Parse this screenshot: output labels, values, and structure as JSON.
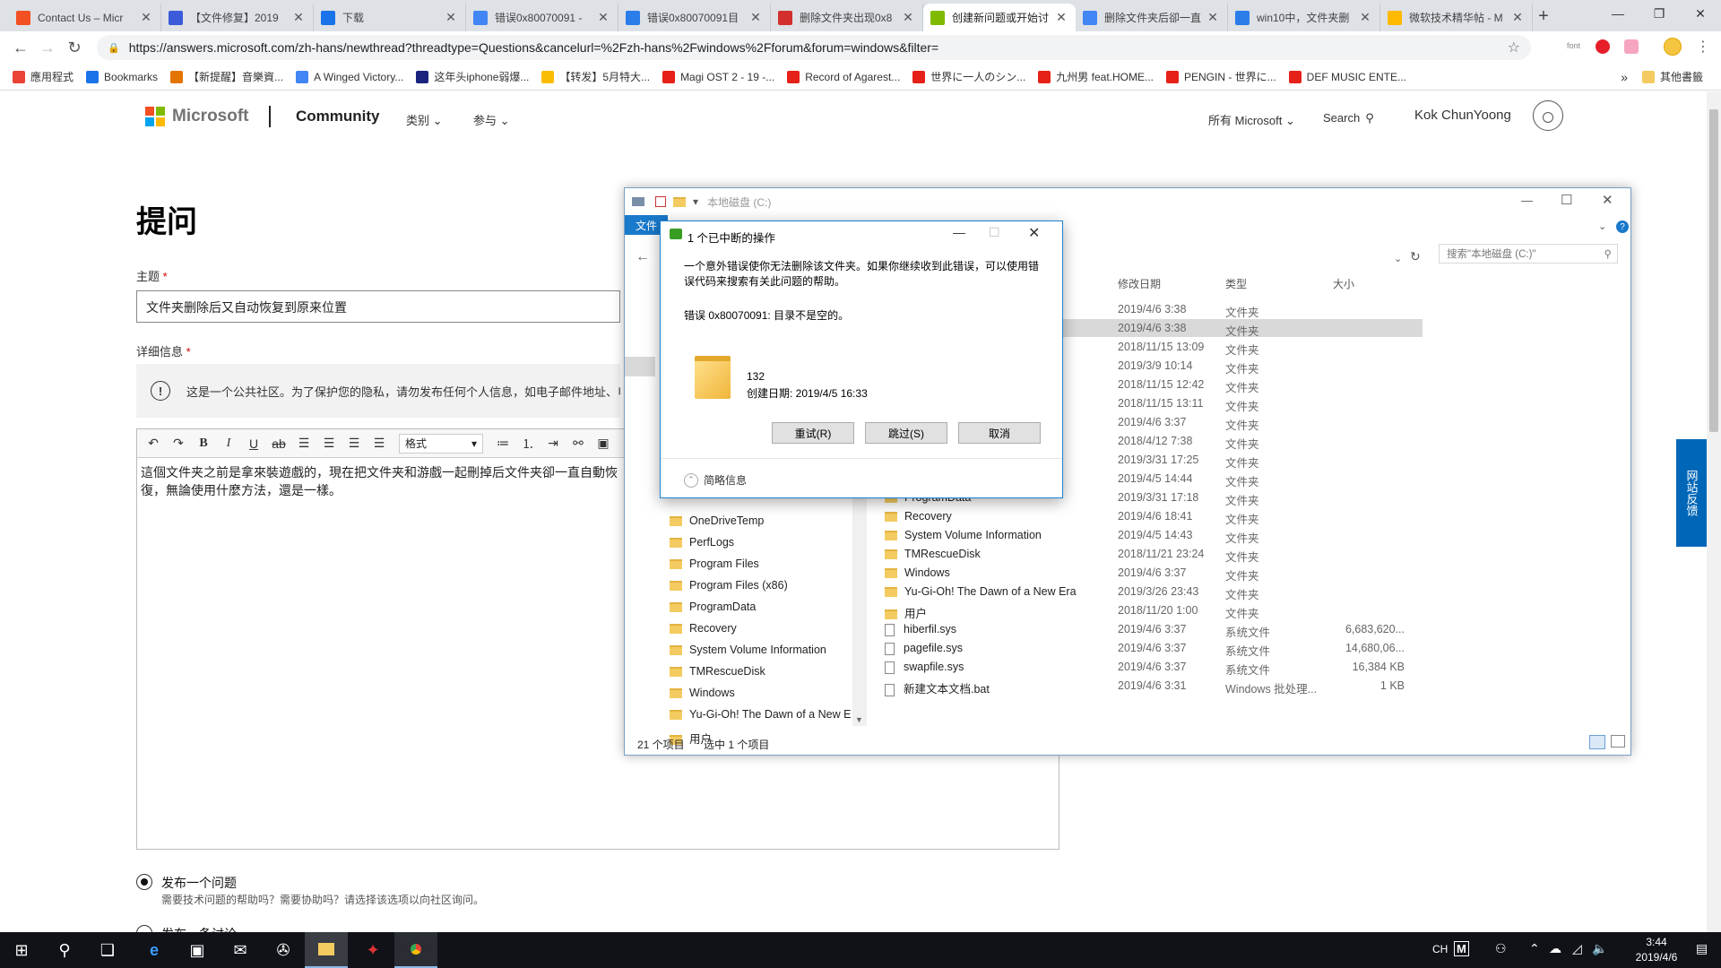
{
  "browser": {
    "tabs": [
      {
        "title": "Contact Us – Micr",
        "fav": "#f25022"
      },
      {
        "title": "【文件修复】2019",
        "fav": "#3b5bdb"
      },
      {
        "title": "下载",
        "fav": "#1a73e8"
      },
      {
        "title": "错误0x80070091 -",
        "fav": "#4285f4"
      },
      {
        "title": "错误0x80070091目",
        "fav": "#2b7de9"
      },
      {
        "title": "删除文件夹出现0x8",
        "fav": "#d32f2f"
      },
      {
        "title": "创建新问题或开始讨",
        "fav": "#7fba00"
      },
      {
        "title": "删除文件夹后卻一直",
        "fav": "#4285f4"
      },
      {
        "title": "win10中，文件夹删",
        "fav": "#2b7de9"
      },
      {
        "title": "微软技术精华帖 - M",
        "fav": "#ffb900"
      }
    ],
    "new_tab": "+",
    "win_minimize": "—",
    "win_restore": "❐",
    "win_close": "✕",
    "url": "https://answers.microsoft.com/zh-hans/newthread?threadtype=Questions&cancelurl=%2Fzh-hans%2Fwindows%2Fforum&forum=windows&filter=",
    "bookmarks": [
      {
        "label": "應用程式",
        "color": "#ea4335"
      },
      {
        "label": "Bookmarks",
        "color": "#1a73e8"
      },
      {
        "label": "【新提醒】音樂資...",
        "color": "#e37400"
      },
      {
        "label": "A Winged Victory...",
        "color": "#4285f4"
      },
      {
        "label": "这年头iphone弱爆...",
        "color": "#1a237e"
      },
      {
        "label": "【转发】5月特大...",
        "color": "#fbbc04"
      },
      {
        "label": "Magi OST 2 - 19 -...",
        "color": "#e62117"
      },
      {
        "label": "Record of Agarest...",
        "color": "#e62117"
      },
      {
        "label": "世界に一人のシン...",
        "color": "#e62117"
      },
      {
        "label": "九州男 feat.HOME...",
        "color": "#e62117"
      },
      {
        "label": "PENGIN - 世界に...",
        "color": "#e62117"
      },
      {
        "label": "DEF MUSIC ENTE...",
        "color": "#e62117"
      }
    ],
    "bookmarks_more": "»",
    "other_bookmarks": "其他書籤",
    "ext_font_label": "font"
  },
  "site": {
    "brand": "Microsoft",
    "community": "Community",
    "nav_categories": "类别",
    "nav_participate": "参与",
    "all_microsoft": "所有 Microsoft",
    "search": "Search",
    "user": "Kok ChunYoong",
    "page_title": "提问",
    "subject_label": "主题",
    "required_mark": "*",
    "subject_value": "文件夹删除后又自动恢复到原来位置",
    "details_label": "详细信息",
    "notice_text": "这是一个公共社区。为了保护您的隐私，请勿发布任何个人信息，如电子邮件地址、电",
    "editor_format": "格式",
    "editor_body": "這個文件夹之前是拿來裝遊戲的，現在把文件夹和游戲一起刪掉后文件夹卻一直自動恢復，無論使用什麼方法，還是一樣。",
    "post_question": "发布一个问题",
    "post_question_hint": "需要技术问题的帮助吗？需要协助吗？请选择该选项以向社区询问。",
    "post_discussion": "发布一条讨论",
    "feedback": "网站反馈"
  },
  "explorer": {
    "title": "本地磁盘 (C:)",
    "file_tab": "文件",
    "search_placeholder": "搜索\"本地磁盘 (C:)\"",
    "col_date": "修改日期",
    "col_type": "类型",
    "col_size": "大小",
    "tree": [
      "OneDriveTemp",
      "PerfLogs",
      "Program Files",
      "Program Files (x86)",
      "ProgramData",
      "Recovery",
      "System Volume Information",
      "TMRescueDisk",
      "Windows",
      "Yu-Gi-Oh! The Dawn of a New E",
      "用户"
    ],
    "files": [
      {
        "name": "",
        "date": "2019/4/6 3:38",
        "type": "文件夹",
        "size": "",
        "kind": "folder",
        "selected": false
      },
      {
        "name": "",
        "date": "2019/4/6 3:38",
        "type": "文件夹",
        "size": "",
        "kind": "folder",
        "selected": true
      },
      {
        "name": "",
        "date": "2018/11/15 13:09",
        "type": "文件夹",
        "size": "",
        "kind": "folder",
        "selected": false
      },
      {
        "name": "",
        "date": "2019/3/9 10:14",
        "type": "文件夹",
        "size": "",
        "kind": "folder",
        "selected": false
      },
      {
        "name": "",
        "date": "2018/11/15 12:42",
        "type": "文件夹",
        "size": "",
        "kind": "folder",
        "selected": false
      },
      {
        "name": "",
        "date": "2018/11/15 13:11",
        "type": "文件夹",
        "size": "",
        "kind": "folder",
        "selected": false
      },
      {
        "name": "",
        "date": "2019/4/6 3:37",
        "type": "文件夹",
        "size": "",
        "kind": "folder",
        "selected": false
      },
      {
        "name": "",
        "date": "2018/4/12 7:38",
        "type": "文件夹",
        "size": "",
        "kind": "folder",
        "selected": false
      },
      {
        "name": "",
        "date": "2019/3/31 17:25",
        "type": "文件夹",
        "size": "",
        "kind": "folder",
        "selected": false
      },
      {
        "name": "",
        "date": "2019/4/5 14:44",
        "type": "文件夹",
        "size": "",
        "kind": "folder",
        "selected": false
      },
      {
        "name": "ProgramData",
        "date": "2019/3/31 17:18",
        "type": "文件夹",
        "size": "",
        "kind": "folder",
        "selected": false
      },
      {
        "name": "Recovery",
        "date": "2019/4/6 18:41",
        "type": "文件夹",
        "size": "",
        "kind": "folder",
        "selected": false
      },
      {
        "name": "System Volume Information",
        "date": "2019/4/5 14:43",
        "type": "文件夹",
        "size": "",
        "kind": "folder",
        "selected": false
      },
      {
        "name": "TMRescueDisk",
        "date": "2018/11/21 23:24",
        "type": "文件夹",
        "size": "",
        "kind": "folder",
        "selected": false
      },
      {
        "name": "Windows",
        "date": "2019/4/6 3:37",
        "type": "文件夹",
        "size": "",
        "kind": "folder",
        "selected": false
      },
      {
        "name": "Yu-Gi-Oh! The Dawn of a New Era",
        "date": "2019/3/26 23:43",
        "type": "文件夹",
        "size": "",
        "kind": "folder",
        "selected": false
      },
      {
        "name": "用户",
        "date": "2018/11/20 1:00",
        "type": "文件夹",
        "size": "",
        "kind": "folder",
        "selected": false
      },
      {
        "name": "hiberfil.sys",
        "date": "2019/4/6 3:37",
        "type": "系统文件",
        "size": "6,683,620...",
        "kind": "file",
        "selected": false
      },
      {
        "name": "pagefile.sys",
        "date": "2019/4/6 3:37",
        "type": "系统文件",
        "size": "14,680,06...",
        "kind": "file",
        "selected": false
      },
      {
        "name": "swapfile.sys",
        "date": "2019/4/6 3:37",
        "type": "系统文件",
        "size": "16,384 KB",
        "kind": "file",
        "selected": false
      },
      {
        "name": "新建文本文档.bat",
        "date": "2019/4/6 3:31",
        "type": "Windows 批处理...",
        "size": "1 KB",
        "kind": "file",
        "selected": false
      }
    ],
    "status_count": "21 个项目",
    "status_selected": "选中 1 个项目"
  },
  "dialog": {
    "title": "1 个已中断的操作",
    "message": "一个意外错误使你无法删除该文件夹。如果你继续收到此错误，可以使用错误代码来搜索有关此问题的帮助。",
    "error": "错误 0x80070091: 目录不是空的。",
    "item_name": "132",
    "item_created": "创建日期: 2019/4/5 16:33",
    "retry": "重试(R)",
    "skip": "跳过(S)",
    "cancel": "取消",
    "less_info": "简略信息"
  },
  "taskbar": {
    "lang": "CH",
    "ime": "M",
    "time": "3:44",
    "date": "2019/4/6"
  }
}
